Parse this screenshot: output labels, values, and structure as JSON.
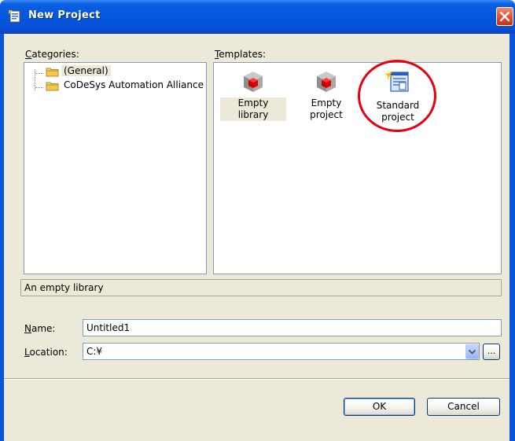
{
  "window": {
    "title": "New Project",
    "title_icon": "new-project-icon",
    "close_icon": "close-icon"
  },
  "categories": {
    "label": "Categories:",
    "label_mnemonic": "C",
    "items": [
      {
        "label": "(General)",
        "icon": "folder-icon",
        "selected": true
      },
      {
        "label": "CoDeSys Automation Alliance",
        "icon": "folder-icon",
        "selected": false
      }
    ]
  },
  "templates": {
    "label": "Templates:",
    "label_mnemonic": "T",
    "items": [
      {
        "label": "Empty library",
        "icon": "red-cube-icon",
        "selected": true
      },
      {
        "label": "Empty project",
        "icon": "red-cube-icon",
        "selected": false
      },
      {
        "label_line1": "Standard",
        "label_line2": "project",
        "icon": "standard-project-icon",
        "selected": false
      }
    ]
  },
  "description": "An empty library",
  "name_field": {
    "label": "Name:",
    "mnemonic": "N",
    "value": "Untitled1"
  },
  "location_field": {
    "label": "Location:",
    "mnemonic": "L",
    "value": "C:¥",
    "browse_label": "..."
  },
  "buttons": {
    "ok": "OK",
    "cancel": "Cancel"
  },
  "colors": {
    "titlebar": "#0555dd",
    "dialog_bg": "#ece9d8",
    "highlight_circle": "#e60012"
  }
}
